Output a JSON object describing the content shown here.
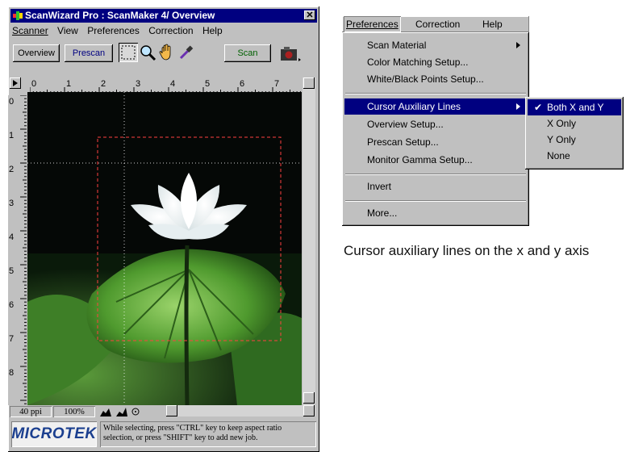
{
  "window": {
    "title": "ScanWizard Pro : ScanMaker 4/ Overview",
    "close_glyph": "✕",
    "menu": [
      "Scanner",
      "View",
      "Preferences",
      "Correction",
      "Help"
    ],
    "toolbar": {
      "overview_label": "Overview",
      "prescan_label": "Prescan",
      "scan_label": "Scan",
      "tools": [
        "marquee-icon",
        "magnifier-icon",
        "hand-icon",
        "eyedropper-icon",
        "camera-icon"
      ]
    },
    "ruler_top_labels": [
      "0",
      "1",
      "2",
      "3",
      "4",
      "5",
      "6",
      "7"
    ],
    "ruler_left_labels": [
      "0",
      "1",
      "2",
      "3",
      "4",
      "5",
      "6",
      "7",
      "8"
    ],
    "status": {
      "resolution": "40 ppi",
      "zoom": "100%"
    },
    "brand": "MICROTEK",
    "hint": "While selecting, press \"CTRL\" key to keep aspect ratio selection, or press \"SHIFT\" key to add new job."
  },
  "menu_figure": {
    "menubar": [
      "Preferences",
      "Correction",
      "Help"
    ],
    "items": [
      "Scan Material",
      "Color Matching Setup...",
      "White/Black Points Setup...",
      "Cursor Auxiliary Lines",
      "Overview Setup...",
      "Prescan Setup...",
      "Monitor Gamma Setup...",
      "Invert",
      "More..."
    ],
    "submenu": [
      "Both X and Y",
      "X Only",
      "Y Only",
      "None"
    ],
    "checked": "Both X and Y",
    "highlight_color": "#000080"
  },
  "caption": "Cursor auxiliary lines on the x and y axis"
}
